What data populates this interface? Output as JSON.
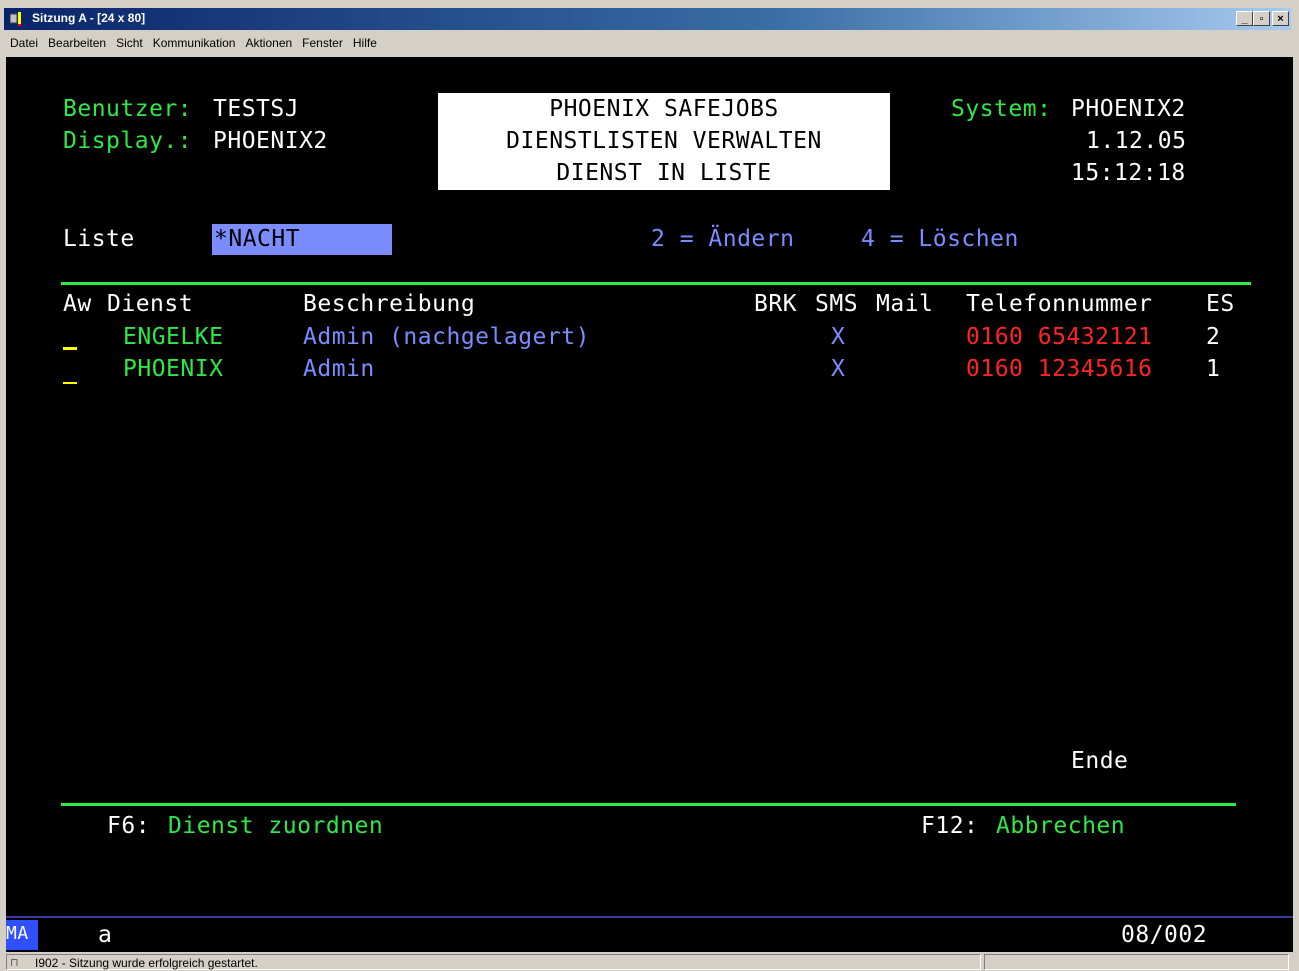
{
  "window": {
    "title": "Sitzung A - [24 x 80]",
    "controls": {
      "minimize": "_",
      "maximize": "▫",
      "close": "×"
    }
  },
  "menu": [
    "Datei",
    "Bearbeiten",
    "Sicht",
    "Kommunikation",
    "Aktionen",
    "Fenster",
    "Hilfe"
  ],
  "screen": {
    "user_label": "Benutzer:",
    "user_value": "TESTSJ",
    "display_label": "Display.:",
    "display_value": "PHOENIX2",
    "header_lines": [
      "PHOENIX SAFEJOBS",
      "DIENSTLISTEN VERWALTEN",
      "DIENST IN LISTE"
    ],
    "system_label": "System:",
    "system_value": "PHOENIX2",
    "date": "1.12.05",
    "time": "15:12:18",
    "list_label": "Liste",
    "list_value": "*NACHT",
    "option_change": "2 = Ändern",
    "option_delete": "4 = Löschen",
    "columns": {
      "aw": "Aw",
      "dienst": "Dienst",
      "beschreibung": "Beschreibung",
      "brk": "BRK",
      "sms": "SMS",
      "mail": "Mail",
      "telefon": "Telefonnummer",
      "es": "ES"
    },
    "rows": [
      {
        "dienst": "ENGELKE",
        "beschreibung": "Admin (nachgelagert)",
        "brk": "",
        "sms": "X",
        "mail": "",
        "telefon": "0160 65432121",
        "es": "2"
      },
      {
        "dienst": "PHOENIX",
        "beschreibung": "Admin",
        "brk": "",
        "sms": "X",
        "mail": "",
        "telefon": "0160 12345616",
        "es": "1"
      }
    ],
    "end_marker": "Ende",
    "fkeys": {
      "f6_key": "F6:",
      "f6_label": "Dienst zuordnen",
      "f12_key": "F12:",
      "f12_label": "Abbrechen"
    }
  },
  "oia": {
    "indicator": "MA",
    "mode": "a",
    "cursor_position": "08/002"
  },
  "statusbar": {
    "message": "I902 - Sitzung wurde erfolgreich gestartet."
  },
  "colors": {
    "field_label": "#2ee84a",
    "field_value": "#ffffff",
    "highlight": "#7b8cff",
    "phone": "#ff2424",
    "cursor": "#ffff00"
  }
}
